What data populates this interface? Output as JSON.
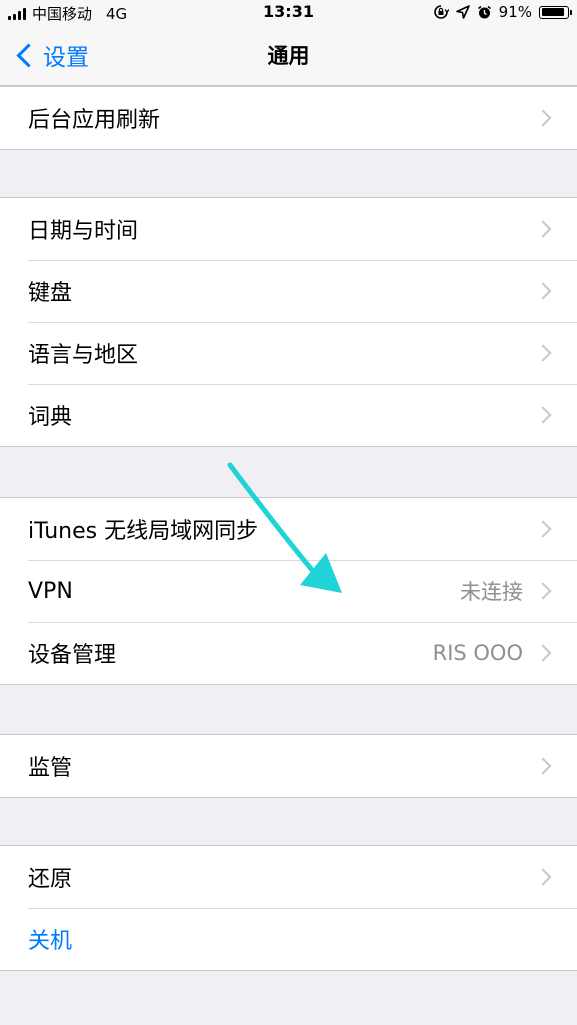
{
  "status_bar": {
    "carrier": "中国移动",
    "network": "4G",
    "time": "13:31",
    "battery_text": "91%",
    "battery_level": 0.91
  },
  "nav": {
    "back_label": "设置",
    "title": "通用"
  },
  "groups": [
    {
      "rows": [
        {
          "label": "后台应用刷新",
          "chevron": true
        }
      ]
    },
    {
      "rows": [
        {
          "label": "日期与时间",
          "chevron": true
        },
        {
          "label": "键盘",
          "chevron": true
        },
        {
          "label": "语言与地区",
          "chevron": true
        },
        {
          "label": "词典",
          "chevron": true
        }
      ]
    },
    {
      "rows": [
        {
          "label": "iTunes 无线局域网同步",
          "chevron": true
        },
        {
          "label": "VPN",
          "detail": "未连接",
          "chevron": true
        },
        {
          "label": "设备管理",
          "detail": "RIS OOO",
          "chevron": true
        }
      ]
    },
    {
      "rows": [
        {
          "label": "监管",
          "chevron": true
        }
      ]
    },
    {
      "rows": [
        {
          "label": "还原",
          "chevron": true
        },
        {
          "label": "关机",
          "chevron": false,
          "style": "blue"
        }
      ]
    }
  ],
  "colors": {
    "accent": "#007aff",
    "annotation_arrow": "#1fd3d6"
  }
}
